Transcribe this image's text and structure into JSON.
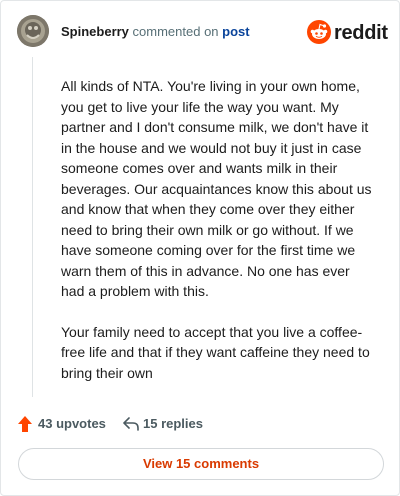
{
  "header": {
    "username": "Spineberry",
    "action_text": "commented on",
    "post_link": "post",
    "brand": "reddit",
    "avatar_icon": "user-avatar-icon",
    "logo_icon": "reddit-snoo-icon"
  },
  "comment": {
    "paragraphs": [
      "All kinds of NTA. You're living in your own home, you get to live your life the way you want. My partner and I don't consume milk, we don't have it in the house and we would not buy it just in case someone comes over and wants milk in their beverages. Our acquaintances know this about us and know that when they come over they either need to bring their own milk or go without. If we have someone coming over for the first time we warn them of this in advance. No one has ever had a problem with this.",
      "Your family need to accept that you live a coffee-free life and that if they want caffeine they need to bring their own"
    ]
  },
  "footer": {
    "upvotes_label": "43 upvotes",
    "replies_label": "15 replies",
    "view_comments_label": "View 15 comments",
    "upvote_icon": "upvote-arrow-icon",
    "reply_icon": "reply-arrow-icon"
  },
  "colors": {
    "brand_orange": "#ff4500",
    "upvote_orange": "#ff4500",
    "link_blue": "#0a449b",
    "cta_text": "#d93a00"
  }
}
